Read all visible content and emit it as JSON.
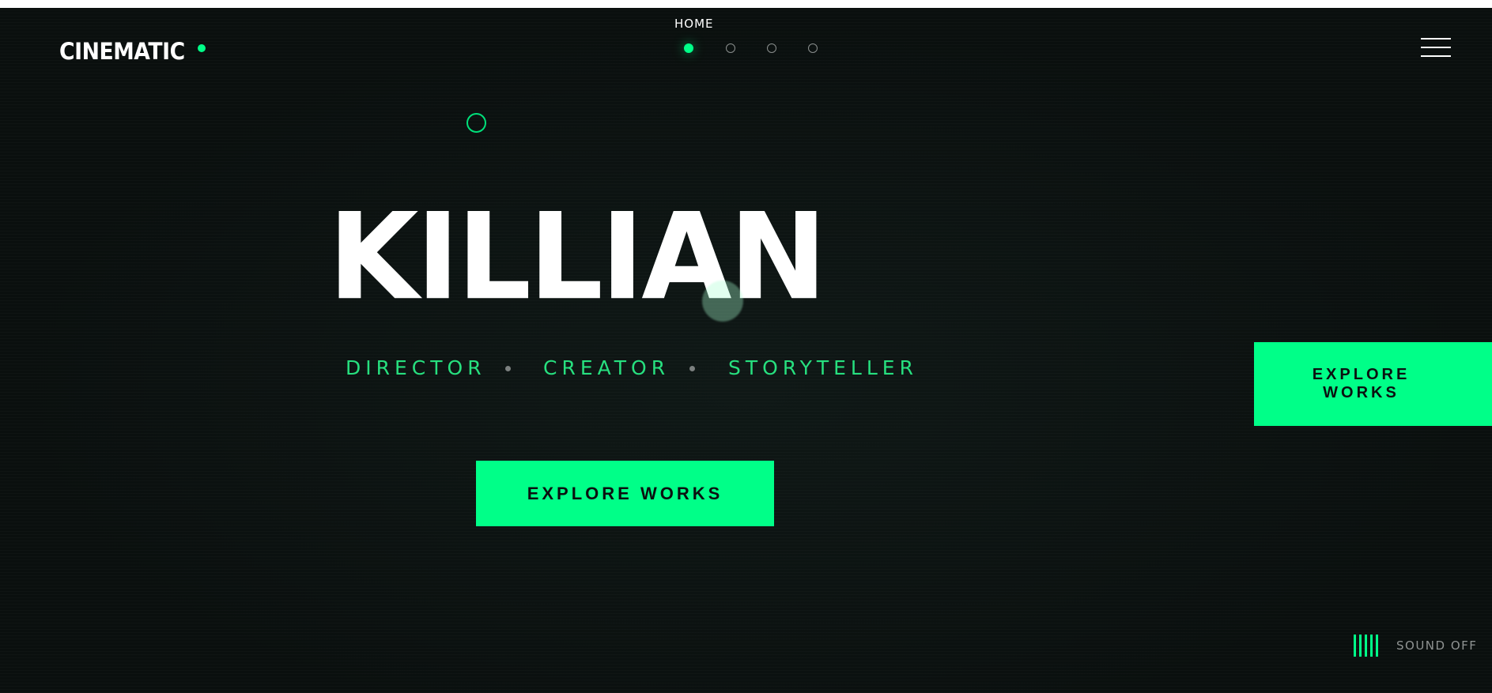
{
  "brand": {
    "logo_text": "CINEMATIC"
  },
  "nav": {
    "current_label": "HOME",
    "dots": [
      "section-1",
      "section-2",
      "section-3",
      "section-4"
    ],
    "active_index": 0
  },
  "hero": {
    "title": "KILLIAN",
    "tagline": [
      "DIRECTOR",
      "CREATOR",
      "STORYTELLER"
    ],
    "cta_label": "EXPLORE WORKS"
  },
  "side_cta": {
    "line1": "EXPLORE",
    "line2": "WORKS"
  },
  "sound": {
    "label": "SOUND OFF"
  },
  "colors": {
    "accent": "#00ff88",
    "background": "#0b1110",
    "text": "#ffffff",
    "muted": "#8f9392"
  },
  "icons": {
    "menu": "hamburger-menu-icon",
    "sound": "sound-bars-icon",
    "cursor": "cursor-ring-icon"
  }
}
